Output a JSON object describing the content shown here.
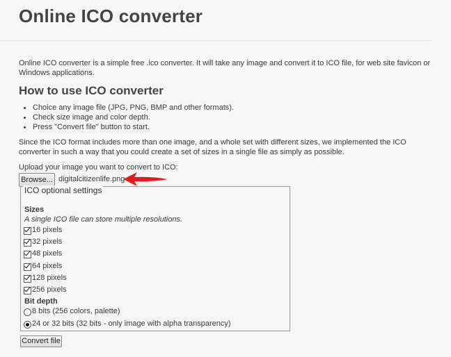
{
  "page": {
    "title": "Online ICO converter",
    "intro": "Online ICO converter is a simple free .ico converter. It will take any image and convert it to ICO file, for web site favicon or Windows applications.",
    "howto_title": "How to use ICO converter",
    "steps": [
      "Choice any image file (JPG, PNG, BMP and other formats).",
      "Check size image and color depth.",
      "Press \"Convert file\" button to start."
    ],
    "note": "Since the ICO format includes more than one image, and a whole set with different sizes, we implemented the ICO converter in such a way that you could create a set of sizes in a single file as simply as possible."
  },
  "upload": {
    "label": "Upload your image you want to convert to ICO:",
    "browse_label": "Browse...",
    "filename": "digitalcitizenlife.png",
    "arrow_color": "#e31b1b"
  },
  "settings": {
    "legend": "ICO optional settings",
    "sizes_title": "Sizes",
    "sizes_hint": "A single ICO file can store multiple resolutions.",
    "sizes": [
      {
        "label": "16 pixels",
        "checked": true
      },
      {
        "label": "32 pixels",
        "checked": true
      },
      {
        "label": "48 pixels",
        "checked": true
      },
      {
        "label": "64 pixels",
        "checked": true
      },
      {
        "label": "128 pixels",
        "checked": true
      },
      {
        "label": "256 pixels",
        "checked": true
      }
    ],
    "depth_title": "Bit depth",
    "depths": [
      {
        "label": "8 bits (256 colors, palette)",
        "selected": false
      },
      {
        "label": "24 or 32 bits (32 bits - only image with alpha transparency)",
        "selected": true
      }
    ]
  },
  "actions": {
    "convert_label": "Convert file"
  }
}
